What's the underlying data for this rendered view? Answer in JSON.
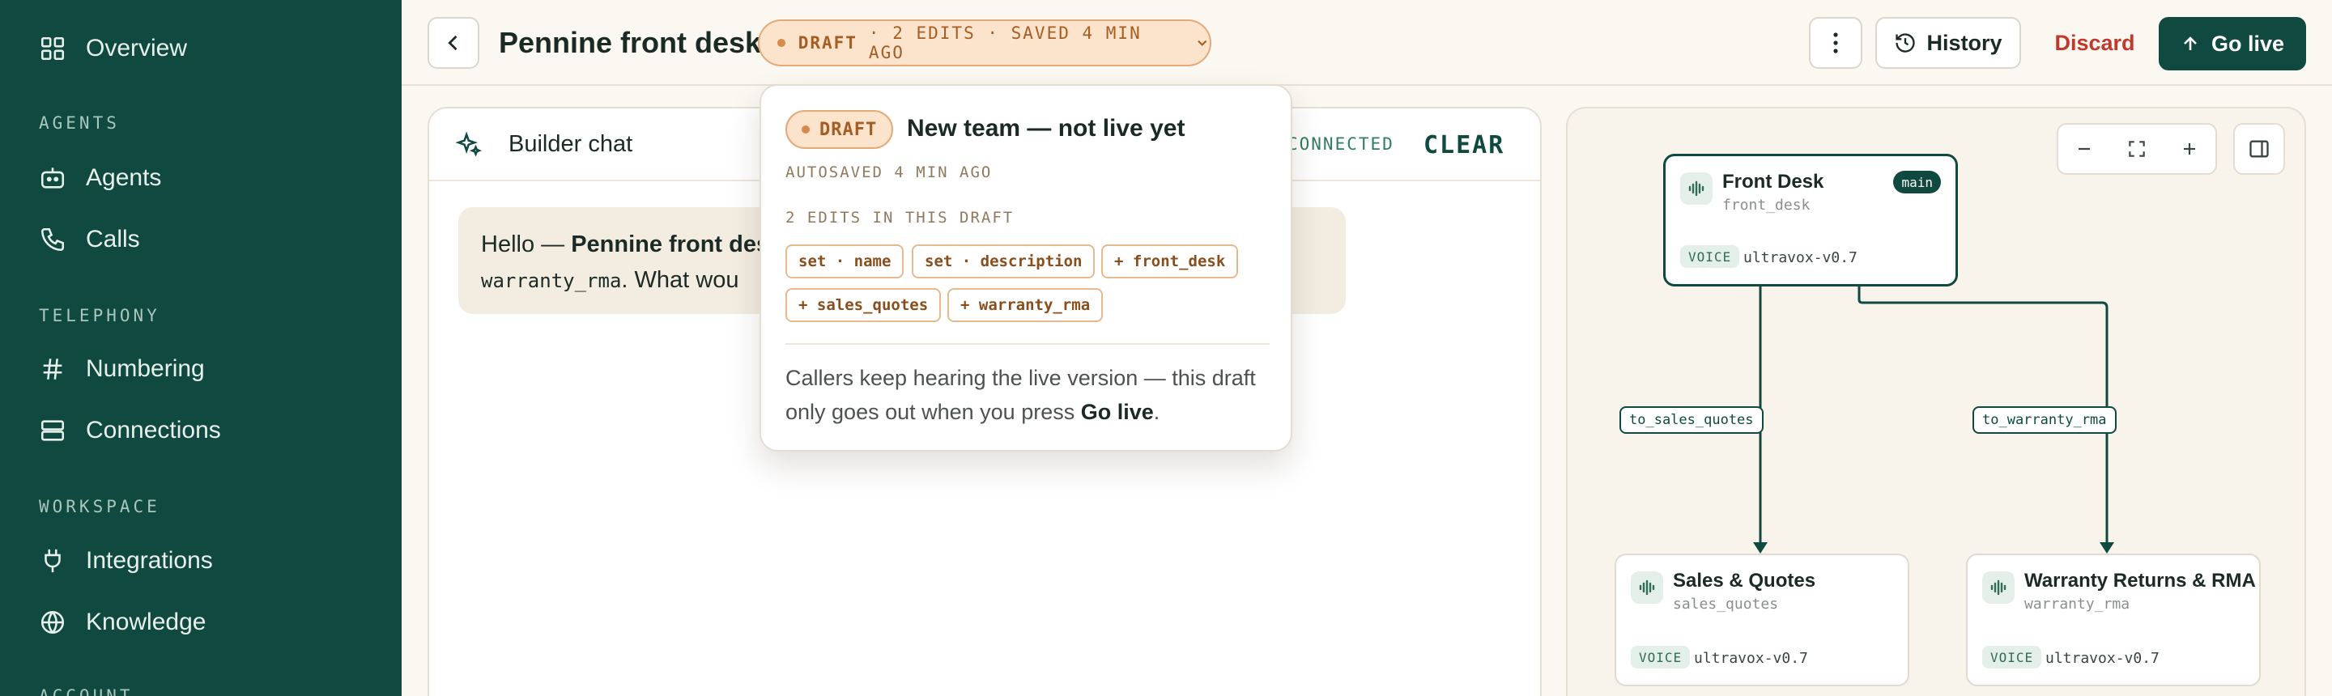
{
  "sidebar": {
    "overview": "Overview",
    "sections": {
      "agents": "AGENTS",
      "telephony": "TELEPHONY",
      "workspace": "WORKSPACE",
      "account": "ACCOUNT"
    },
    "items": {
      "agents": "Agents",
      "calls": "Calls",
      "numbering": "Numbering",
      "connections": "Connections",
      "integrations": "Integrations",
      "knowledge": "Knowledge"
    }
  },
  "header": {
    "title": "Pennine front desk",
    "draft_status": "DRAFT",
    "draft_detail": "· 2 EDITS · SAVED 4 MIN AGO",
    "history": "History",
    "discard": "Discard",
    "go_live": "Go live"
  },
  "chat": {
    "title": "Builder chat",
    "status": "CONNECTED",
    "clear": "CLEAR",
    "message_pre": "Hello — ",
    "message_bold": "Pennine front des",
    "message_code": "warranty_rma",
    "message_post": ". What wou"
  },
  "popover": {
    "badge": "DRAFT",
    "title": "New team — not live yet",
    "autosaved": "AUTOSAVED 4 MIN AGO",
    "edits_heading": "2 EDITS IN THIS DRAFT",
    "chips": [
      "set · name",
      "set · description",
      "+ front_desk",
      "+ sales_quotes",
      "+ warranty_rma"
    ],
    "note_pre": "Callers keep hearing the live version — this draft only goes out when you press ",
    "note_bold": "Go live",
    "note_post": "."
  },
  "canvas": {
    "nodes": {
      "front": {
        "name": "Front Desk",
        "slug": "front_desk",
        "voice": "VOICE",
        "model": "ultravox-v0.7",
        "badge": "main"
      },
      "sales": {
        "name": "Sales & Quotes",
        "slug": "sales_quotes",
        "voice": "VOICE",
        "model": "ultravox-v0.7"
      },
      "warranty": {
        "name": "Warranty Returns & RMA",
        "slug": "warranty_rma",
        "voice": "VOICE",
        "model": "ultravox-v0.7"
      }
    },
    "edges": {
      "to_sales": "to_sales_quotes",
      "to_warranty": "to_warranty_rma"
    }
  },
  "colors": {
    "brand": "#10493f",
    "draft": "#fbe3cc",
    "danger": "#c0392b"
  }
}
